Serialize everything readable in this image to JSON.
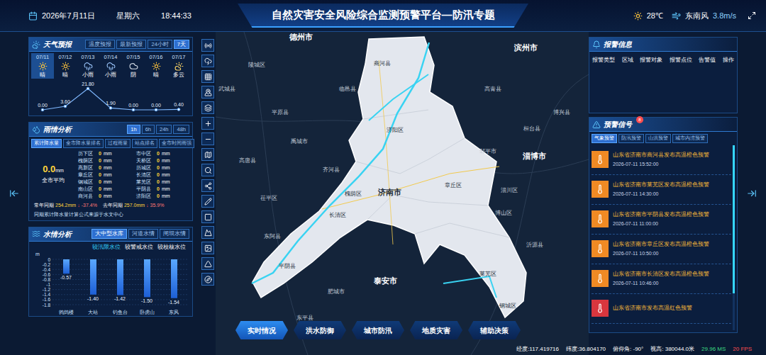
{
  "header": {
    "date": "2026年7月11日",
    "weekday": "星期六",
    "time": "18:44:33",
    "title": "自然灾害安全风险综合监测预警平台—防汛专题",
    "temperature": "28℃",
    "wind_direction": "东南风",
    "wind_speed": "3.8m/s"
  },
  "weather": {
    "title": "天气预报",
    "tabs": [
      {
        "label": "温度预报",
        "selected": false
      },
      {
        "label": "最新预报",
        "selected": false
      },
      {
        "label": "24小时",
        "selected": false
      },
      {
        "label": "7天",
        "selected": true
      }
    ],
    "days": [
      {
        "date": "07/11",
        "weather": "晴",
        "kind": "sunny",
        "rain": "0.00",
        "selected": true
      },
      {
        "date": "07/12",
        "weather": "晴",
        "kind": "sunny",
        "rain": "3.60",
        "selected": false
      },
      {
        "date": "07/13",
        "weather": "小雨",
        "kind": "rain",
        "rain": "21.80",
        "selected": false
      },
      {
        "date": "07/14",
        "weather": "小雨",
        "kind": "rain",
        "rain": "1.90",
        "selected": false
      },
      {
        "date": "07/15",
        "weather": "阴",
        "kind": "cloudy",
        "rain": "0.00",
        "selected": false
      },
      {
        "date": "07/16",
        "weather": "晴",
        "kind": "sunny",
        "rain": "0.00",
        "selected": false
      },
      {
        "date": "07/17",
        "weather": "多云",
        "kind": "partly",
        "rain": "0.40",
        "selected": false
      }
    ],
    "rain_values": [
      0,
      3.6,
      21.8,
      1.9,
      0,
      0,
      0.4
    ]
  },
  "rain": {
    "title": "雨情分析",
    "tabs": [
      {
        "label": "1h",
        "selected": true
      },
      {
        "label": "6h",
        "selected": false
      },
      {
        "label": "24h",
        "selected": false
      },
      {
        "label": "48h",
        "selected": false
      }
    ],
    "subtabs": [
      {
        "label": "累计降水量",
        "selected": true
      },
      {
        "label": "全市降水量排名",
        "selected": false
      },
      {
        "label": "过程雨量",
        "selected": false
      },
      {
        "label": "站点排名",
        "selected": false
      },
      {
        "label": "全市时间雨强",
        "selected": false
      }
    ],
    "average": {
      "value": "0.0",
      "unit": "mm",
      "label": "全市平均"
    },
    "districts": [
      {
        "name": "历下区",
        "value": "0",
        "unit": "mm"
      },
      {
        "name": "槐荫区",
        "value": "0",
        "unit": "mm"
      },
      {
        "name": "高新区",
        "value": "0",
        "unit": "mm"
      },
      {
        "name": "章丘区",
        "value": "0",
        "unit": "mm"
      },
      {
        "name": "钢城区",
        "value": "0",
        "unit": "mm"
      },
      {
        "name": "南山区",
        "value": "0",
        "unit": "mm"
      },
      {
        "name": "商河县",
        "value": "0",
        "unit": "mm"
      },
      {
        "name": "市中区",
        "value": "0",
        "unit": "mm"
      },
      {
        "name": "天桥区",
        "value": "0",
        "unit": "mm"
      },
      {
        "name": "历城区",
        "value": "0",
        "unit": "mm"
      },
      {
        "name": "长清区",
        "value": "0",
        "unit": "mm"
      },
      {
        "name": "莱芜区",
        "value": "0",
        "unit": "mm"
      },
      {
        "name": "平阴县",
        "value": "0",
        "unit": "mm"
      },
      {
        "name": "济阳区",
        "value": "0",
        "unit": "mm"
      }
    ],
    "comparisons": [
      {
        "label": "常年同期",
        "value": "254.2mm",
        "arrow": "↓",
        "percent": "-37.4%"
      },
      {
        "label": "去年同期",
        "value": "257.0mm",
        "arrow": "↓",
        "percent": "35.9%"
      }
    ],
    "note": "同期累计降水量计算公式来源于水文中心"
  },
  "water": {
    "title": "水情分析",
    "tabs": [
      {
        "label": "大中型水库",
        "selected": true
      },
      {
        "label": "河道水情",
        "selected": false
      },
      {
        "label": "闸坝水情",
        "selected": false
      }
    ],
    "legend": [
      {
        "label": "较汛限水位",
        "selected": true
      },
      {
        "label": "较警戒水位",
        "selected": false
      },
      {
        "label": "较校核水位",
        "selected": false
      }
    ],
    "unit": "m",
    "ticks": [
      "0",
      "-0.2",
      "-0.4",
      "-0.6",
      "-0.8",
      "-1",
      "-1.2",
      "-1.4",
      "-1.6",
      "-1.8"
    ],
    "tick_values": [
      0,
      -0.2,
      -0.4,
      -0.6,
      -0.8,
      -1,
      -1.2,
      -1.4,
      -1.6,
      -1.8
    ],
    "bars": [
      {
        "name": "鹁鸽楼",
        "value": -0.57,
        "label": "-0.57"
      },
      {
        "name": "大站",
        "value": -1.4,
        "label": "-1.40"
      },
      {
        "name": "钓鱼台",
        "value": -1.42,
        "label": "-1.42"
      },
      {
        "name": "卧虎山",
        "value": -1.5,
        "label": "-1.50"
      },
      {
        "name": "东风",
        "value": -1.54,
        "label": "-1.54"
      }
    ]
  },
  "map": {
    "labels": [
      {
        "name": "德州市",
        "major": true,
        "on_region": false
      },
      {
        "name": "滨州市",
        "major": true,
        "on_region": false
      },
      {
        "name": "商河县",
        "major": false,
        "on_region": true
      },
      {
        "name": "陵城区",
        "major": false,
        "on_region": false
      },
      {
        "name": "武城县",
        "major": false,
        "on_region": false
      },
      {
        "name": "临邑县",
        "major": false,
        "on_region": false
      },
      {
        "name": "高青县",
        "major": false,
        "on_region": false
      },
      {
        "name": "平原县",
        "major": false,
        "on_region": false
      },
      {
        "name": "桓台县",
        "major": false,
        "on_region": false
      },
      {
        "name": "博兴县",
        "major": false,
        "on_region": false
      },
      {
        "name": "济阳区",
        "major": false,
        "on_region": true
      },
      {
        "name": "禹城市",
        "major": false,
        "on_region": false
      },
      {
        "name": "邹平市",
        "major": false,
        "on_region": false
      },
      {
        "name": "淄博市",
        "major": true,
        "on_region": false
      },
      {
        "name": "高唐县",
        "major": false,
        "on_region": false
      },
      {
        "name": "齐河县",
        "major": false,
        "on_region": false
      },
      {
        "name": "章丘区",
        "major": false,
        "on_region": true
      },
      {
        "name": "淄川区",
        "major": false,
        "on_region": false
      },
      {
        "name": "济南市",
        "major": true,
        "on_region": true
      },
      {
        "name": "槐荫区",
        "major": false,
        "on_region": true
      },
      {
        "name": "茌平区",
        "major": false,
        "on_region": false
      },
      {
        "name": "博山区",
        "major": false,
        "on_region": false
      },
      {
        "name": "长清区",
        "major": false,
        "on_region": true
      },
      {
        "name": "东阿县",
        "major": false,
        "on_region": false
      },
      {
        "name": "沂源县",
        "major": false,
        "on_region": false
      },
      {
        "name": "平阴县",
        "major": false,
        "on_region": true
      },
      {
        "name": "泰安市",
        "major": true,
        "on_region": false
      },
      {
        "name": "莱芜区",
        "major": false,
        "on_region": true
      },
      {
        "name": "肥城市",
        "major": false,
        "on_region": false
      },
      {
        "name": "钢城区",
        "major": false,
        "on_region": true
      },
      {
        "name": "东平县",
        "major": false,
        "on_region": false
      }
    ]
  },
  "nav": [
    {
      "label": "实时情况",
      "selected": true
    },
    {
      "label": "洪水防御",
      "selected": false
    },
    {
      "label": "城市防汛",
      "selected": false
    },
    {
      "label": "地质灾害",
      "selected": false
    },
    {
      "label": "辅助决策",
      "selected": false
    }
  ],
  "alarm": {
    "title": "报警信息",
    "columns": [
      "报警类型",
      "区域",
      "报警对象",
      "报警点位",
      "告警值",
      "操作"
    ]
  },
  "warnings": {
    "title": "预警信号",
    "badge": "8",
    "tabs": [
      {
        "label": "气象预警",
        "selected": true
      },
      {
        "label": "防汛预警",
        "selected": false
      },
      {
        "label": "山洪预警",
        "selected": false
      },
      {
        "label": "城市内涝预警",
        "selected": false
      }
    ],
    "items": [
      {
        "text": "山东省济南市商河县发布高温橙色预警",
        "time": "2026-07-11 15:52:00",
        "color": "#f08a24"
      },
      {
        "text": "山东省济南市莱芜区发布高温橙色预警",
        "time": "2026-07-11 14:30:00",
        "color": "#f08a24"
      },
      {
        "text": "山东省济南市平阴县发布高温橙色预警",
        "time": "2026-07-11 11:00:00",
        "color": "#f08a24"
      },
      {
        "text": "山东省济南市章丘区发布高温橙色预警",
        "time": "2026-07-11 10:50:00",
        "color": "#f08a24"
      },
      {
        "text": "山东省济南市长清区发布高温橙色预警",
        "time": "2026-07-11 10:46:00",
        "color": "#f08a24"
      },
      {
        "text": "山东省济南市发布高温红色预警",
        "time": "",
        "color": "#d9363e"
      }
    ],
    "scrollbar": {
      "level": 0.8
    }
  },
  "status": {
    "coords": [
      "经度:117.419716",
      "纬度:36.804170",
      "俯仰角: -90°",
      "视高: 380044.0米"
    ],
    "perf": [
      {
        "text": "29.96 MS",
        "color": "#3ddc84"
      },
      {
        "text": "20 FPS",
        "color": "#ff4d4f"
      }
    ]
  }
}
